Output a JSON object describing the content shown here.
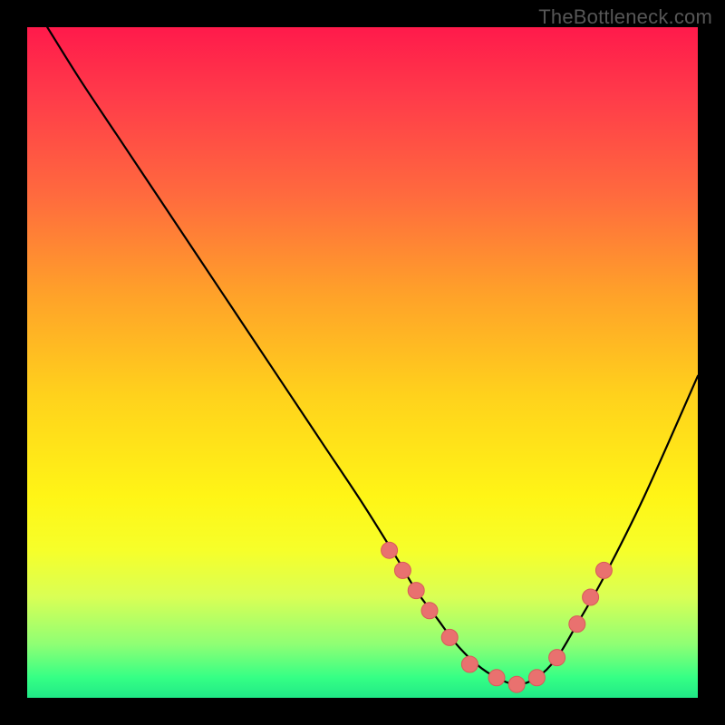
{
  "watermark": "TheBottleneck.com",
  "colors": {
    "dot_fill": "#e9716f",
    "dot_stroke": "#d85a58",
    "curve": "#000000",
    "frame": "#000000"
  },
  "chart_data": {
    "type": "line",
    "title": "",
    "xlabel": "",
    "ylabel": "",
    "xlim": [
      0,
      100
    ],
    "ylim": [
      0,
      100
    ],
    "grid": false,
    "series": [
      {
        "name": "curve",
        "x": [
          3,
          8,
          14,
          20,
          26,
          32,
          38,
          44,
          50,
          55,
          58,
          61,
          64,
          67,
          70,
          73,
          76,
          79,
          82,
          86,
          92,
          100
        ],
        "y": [
          100,
          92,
          83,
          74,
          65,
          56,
          47,
          38,
          29,
          21,
          16,
          12,
          8,
          5,
          3,
          2,
          3,
          6,
          11,
          18,
          30,
          48
        ]
      }
    ],
    "dot_series": {
      "x": [
        54,
        56,
        58,
        60,
        63,
        66,
        70,
        73,
        76,
        79,
        82,
        84,
        86
      ],
      "y": [
        22,
        19,
        16,
        13,
        9,
        5,
        3,
        2,
        3,
        6,
        11,
        15,
        19
      ]
    }
  }
}
